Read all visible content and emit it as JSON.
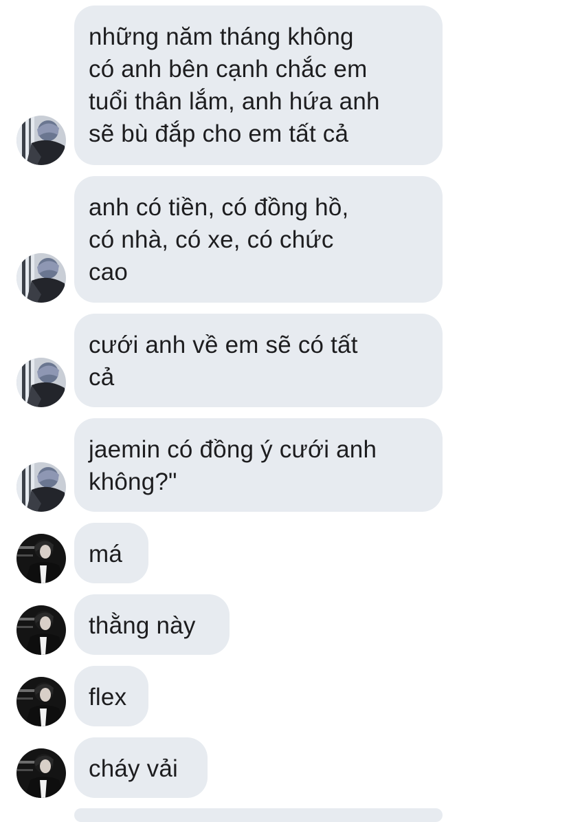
{
  "colors": {
    "bubble_bg": "#e7ebf0",
    "text": "#1d1d1f",
    "background": "#ffffff"
  },
  "avatars": {
    "user_a": "avatar-icon-user-a",
    "user_b": "avatar-icon-user-b"
  },
  "messages": [
    {
      "sender": "user_a",
      "text": "những năm tháng không\ncó anh bên cạnh chắc em\ntuổi thân lắm, anh hứa anh\nsẽ bù đắp cho em tất cả"
    },
    {
      "sender": "user_a",
      "text": "anh có tiền, có đồng hồ,\ncó nhà, có xe, có chức\ncao"
    },
    {
      "sender": "user_a",
      "text": "cưới anh về em sẽ có tất\ncả"
    },
    {
      "sender": "user_a",
      "text": "jaemin có đồng ý cưới anh\nkhông?\""
    },
    {
      "sender": "user_b",
      "text": "má"
    },
    {
      "sender": "user_b",
      "text": "thằng này"
    },
    {
      "sender": "user_b",
      "text": "flex"
    },
    {
      "sender": "user_b",
      "text": "cháy vải"
    }
  ]
}
